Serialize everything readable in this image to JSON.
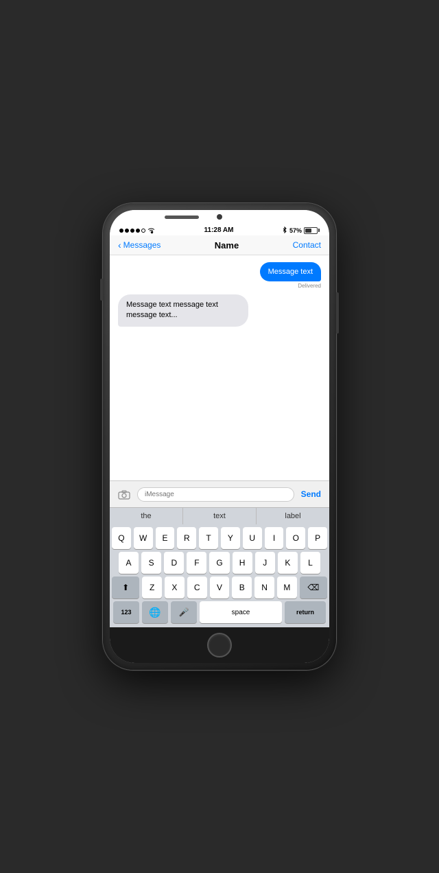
{
  "status_bar": {
    "time": "11:28 AM",
    "battery_percent": "57%",
    "signal_dots": 4
  },
  "nav": {
    "back_label": "Messages",
    "title": "Name",
    "contact_label": "Contact"
  },
  "messages": [
    {
      "type": "out",
      "text": "Message text",
      "status": "Delivered"
    },
    {
      "type": "in",
      "text": "Message text message text message text..."
    }
  ],
  "input": {
    "placeholder": "iMessage",
    "send_label": "Send"
  },
  "autocomplete": [
    {
      "label": "the"
    },
    {
      "label": "text"
    },
    {
      "label": "label"
    }
  ],
  "keyboard": {
    "rows": [
      [
        "Q",
        "W",
        "E",
        "R",
        "T",
        "Y",
        "U",
        "I",
        "O",
        "P"
      ],
      [
        "A",
        "S",
        "D",
        "F",
        "G",
        "H",
        "J",
        "K",
        "L"
      ],
      [
        "Z",
        "X",
        "C",
        "V",
        "B",
        "N",
        "M"
      ]
    ],
    "bottom": {
      "numbers": "123",
      "space": "space",
      "return": "return"
    }
  },
  "icons": {
    "camera": "📷",
    "shift": "⬆",
    "delete": "⌫",
    "globe": "🌐",
    "mic": "🎤"
  }
}
